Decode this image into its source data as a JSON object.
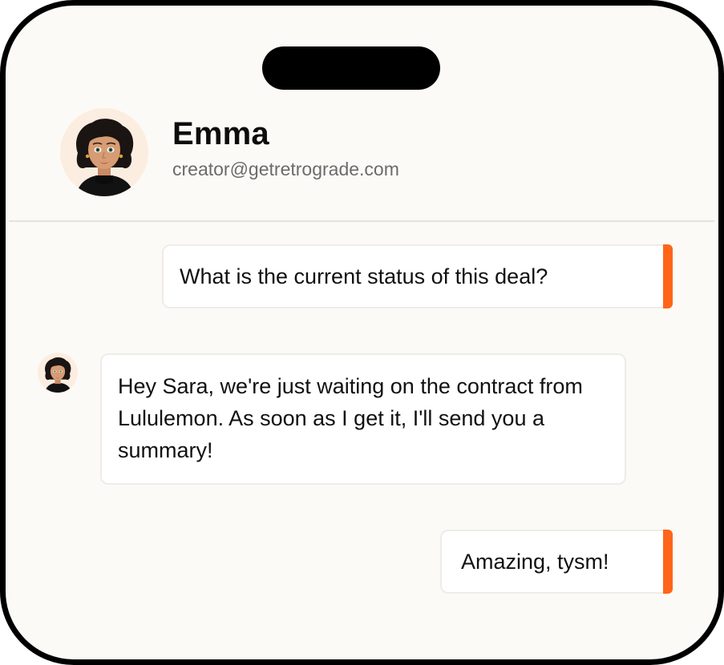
{
  "contact": {
    "name": "Emma",
    "email": "creator@getretrograde.com",
    "avatar_icon": "woman-portrait-avatar",
    "avatar_bg": "#fbeee1"
  },
  "messages": [
    {
      "direction": "outgoing",
      "text": "What is the current status of this deal?"
    },
    {
      "direction": "incoming",
      "sender": "Emma",
      "text": "Hey Sara, we're just waiting on the contract from Lululemon. As soon as I get it, I'll send you a summary!"
    },
    {
      "direction": "outgoing",
      "text": "Amazing, tysm!"
    }
  ],
  "colors": {
    "accent": "#ff6519",
    "background": "#fcfaf6",
    "bubble": "#ffffff",
    "frame": "#000000"
  }
}
